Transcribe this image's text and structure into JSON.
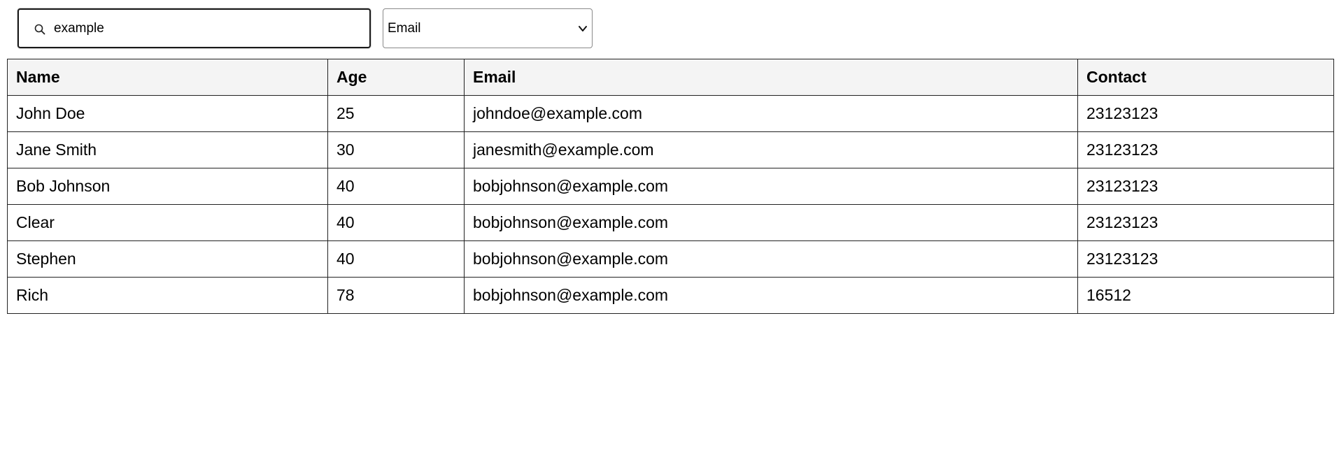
{
  "search": {
    "value": "example",
    "icon": "search-icon"
  },
  "filter": {
    "selected": "Email",
    "icon": "chevron-down-icon"
  },
  "table": {
    "headers": [
      "Name",
      "Age",
      "Email",
      "Contact"
    ],
    "rows": [
      [
        "John Doe",
        "25",
        "johndoe@example.com",
        "23123123"
      ],
      [
        "Jane Smith",
        "30",
        "janesmith@example.com",
        "23123123"
      ],
      [
        "Bob Johnson",
        "40",
        "bobjohnson@example.com",
        "23123123"
      ],
      [
        "Clear",
        "40",
        "bobjohnson@example.com",
        "23123123"
      ],
      [
        "Stephen",
        "40",
        "bobjohnson@example.com",
        "23123123"
      ],
      [
        "Rich",
        "78",
        "bobjohnson@example.com",
        "16512"
      ]
    ]
  },
  "colors": {
    "header_background": "#f4f4f4",
    "border": "#222222",
    "search_border": "#1a1a1a"
  }
}
